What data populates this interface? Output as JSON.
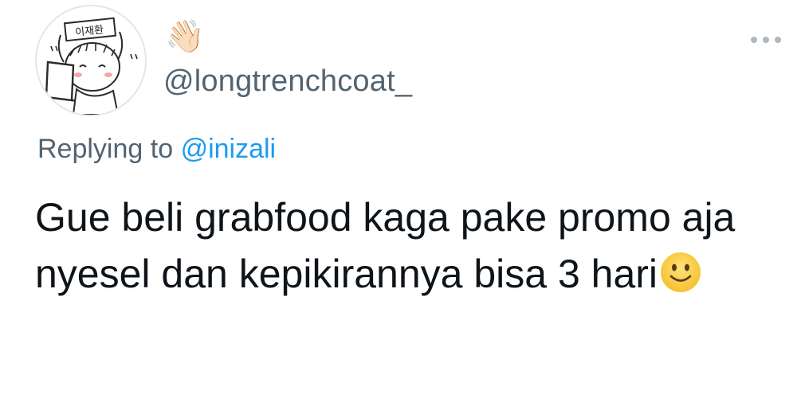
{
  "author": {
    "display_name": "👋🏻",
    "handle": "@longtrenchcoat_",
    "avatar_label": "이재환"
  },
  "reply": {
    "prefix": "Replying to",
    "mention": "@inizali"
  },
  "tweet": {
    "text": "Gue beli grabfood kaga pake promo aja nyesel dan kepikirannya bisa 3 hari",
    "trailing_emoji": "slightly-smiling-face"
  },
  "colors": {
    "text_primary": "#0f1419",
    "text_secondary": "#536471",
    "accent": "#1d9bf0"
  },
  "icons": {
    "more": "more-horizontal-icon"
  }
}
